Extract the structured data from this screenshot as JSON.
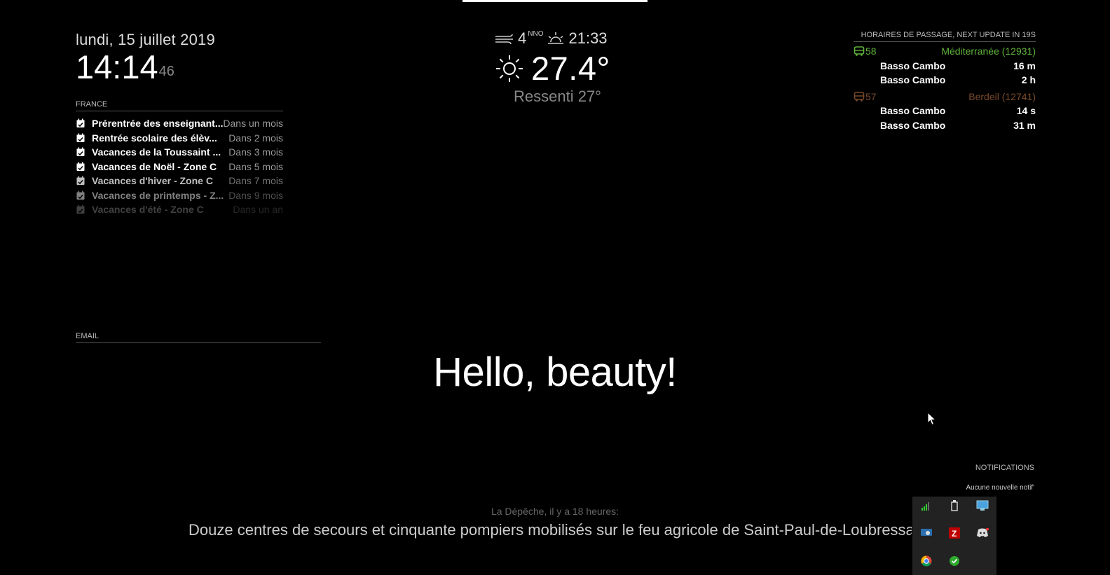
{
  "clock": {
    "date": "lundi, 15 juillet 2019",
    "time": "14:14",
    "seconds": "46"
  },
  "calendar": {
    "header": "FRANCE",
    "events": [
      {
        "title": "Prérentrée des enseignant...",
        "when": "Dans un mois",
        "opacity": 1.0
      },
      {
        "title": "Rentrée scolaire des élèv...",
        "when": "Dans 2 mois",
        "opacity": 1.0
      },
      {
        "title": "Vacances de la Toussaint ...",
        "when": "Dans 3 mois",
        "opacity": 1.0
      },
      {
        "title": "Vacances de Noël - Zone C",
        "when": "Dans 5 mois",
        "opacity": 1.0
      },
      {
        "title": "Vacances d'hiver - Zone C",
        "when": "Dans 7 mois",
        "opacity": 0.75
      },
      {
        "title": "Vacances de printemps - Z...",
        "when": "Dans 9 mois",
        "opacity": 0.5
      },
      {
        "title": "Vacances d'été - Zone C",
        "when": "Dans un an",
        "opacity": 0.25
      }
    ],
    "icon": "calendar-check-icon"
  },
  "email": {
    "header": "EMAIL"
  },
  "weather": {
    "wind_speed": "4",
    "wind_dir": "NNO",
    "sunset": "21:33",
    "temperature": "27.4°",
    "feels_like": "Ressenti 27°",
    "icons": {
      "wind": "wind-icon",
      "sunset": "sunset-icon",
      "condition": "sun-icon"
    }
  },
  "bus": {
    "header": "HORAIRES DE PASSAGE, NEXT UPDATE IN 19S",
    "lines": [
      {
        "number": "58",
        "stop": "Méditerranée (12931)",
        "color": "#5fb33a",
        "departures": [
          {
            "dest": "Basso Cambo",
            "time": "16 m"
          },
          {
            "dest": "Basso Cambo",
            "time": "2 h"
          }
        ]
      },
      {
        "number": "57",
        "stop": "Berdeil (12741)",
        "color": "#7a4a2a",
        "departures": [
          {
            "dest": "Basso Cambo",
            "time": "14 s"
          },
          {
            "dest": "Basso Cambo",
            "time": "31 m"
          }
        ]
      }
    ]
  },
  "compliment": "Hello, beauty!",
  "notifications": {
    "header": "NOTIFICATIONS",
    "empty_text": "Aucune nouvelle notif'"
  },
  "news": {
    "source": "La Dépêche, il y a 18 heures:",
    "headline": "Douze centres de secours et cinquante pompiers mobilisés sur le feu agricole de Saint-Paul-de-Loubressac dans le Lot"
  },
  "tray": {
    "icons": [
      "signal-bars-icon",
      "usb-drive-icon",
      "network-icon",
      "remote-desktop-icon",
      "filezilla-icon",
      "discord-icon",
      "chrome-icon",
      "check-circle-icon"
    ]
  }
}
